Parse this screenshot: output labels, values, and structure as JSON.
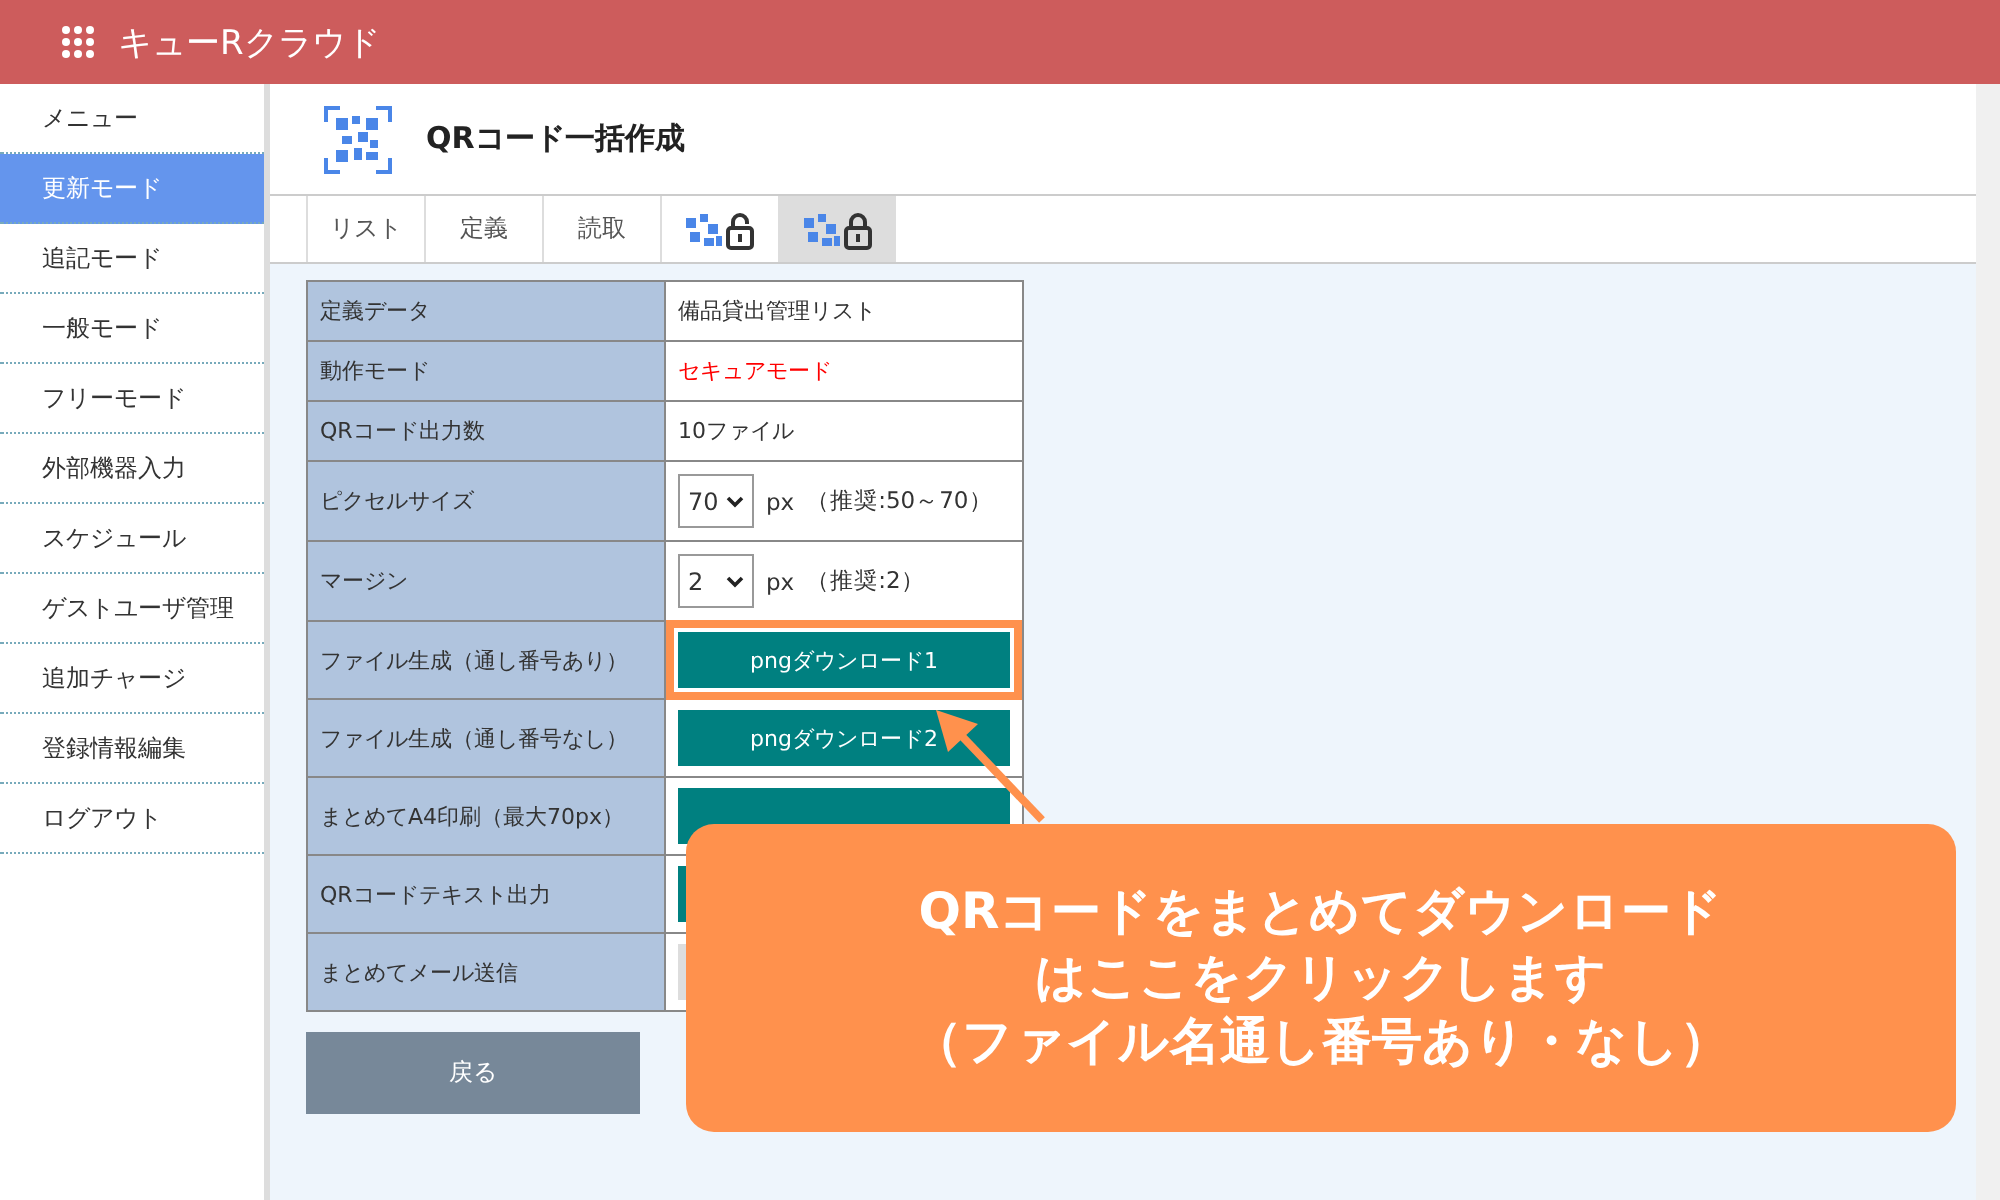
{
  "header": {
    "title": "キューRクラウド"
  },
  "sidebar": {
    "items": [
      {
        "label": "メニュー",
        "selected": false
      },
      {
        "label": "更新モード",
        "selected": true
      },
      {
        "label": "追記モード",
        "selected": false
      },
      {
        "label": "一般モード",
        "selected": false
      },
      {
        "label": "フリーモード",
        "selected": false
      },
      {
        "label": "外部機器入力",
        "selected": false
      },
      {
        "label": "スケジュール",
        "selected": false
      },
      {
        "label": "ゲストユーザ管理",
        "selected": false
      },
      {
        "label": "追加チャージ",
        "selected": false
      },
      {
        "label": "登録情報編集",
        "selected": false
      },
      {
        "label": "ログアウト",
        "selected": false
      }
    ]
  },
  "page": {
    "title": "QRコード一括作成"
  },
  "tabs": [
    {
      "kind": "text",
      "label": "リスト",
      "selected": false
    },
    {
      "kind": "text",
      "label": "定義",
      "selected": false
    },
    {
      "kind": "text",
      "label": "読取",
      "selected": false
    },
    {
      "kind": "qr-unlocked",
      "selected": false
    },
    {
      "kind": "qr-locked",
      "selected": true
    }
  ],
  "table": {
    "rows": [
      {
        "label": "定義データ",
        "kind": "text",
        "value": "備品貸出管理リスト"
      },
      {
        "label": "動作モード",
        "kind": "alert",
        "value": "セキュアモード"
      },
      {
        "label": "QRコード出力数",
        "kind": "text",
        "value": "10ファイル"
      },
      {
        "label": "ピクセルサイズ",
        "kind": "select",
        "value": "70",
        "unit": "px",
        "note": "（推奨:50～70）"
      },
      {
        "label": "マージン",
        "kind": "select",
        "value": "2",
        "unit": "px",
        "note": "（推奨:2）"
      },
      {
        "label": "ファイル生成（通し番号あり）",
        "kind": "button",
        "button": {
          "label": "pngダウンロード1",
          "kind": "primary",
          "highlighted": true
        }
      },
      {
        "label": "ファイル生成（通し番号なし）",
        "kind": "button",
        "button": {
          "label": "pngダウンロード2",
          "kind": "primary"
        }
      },
      {
        "label": "まとめてA4印刷（最大70px）",
        "kind": "button",
        "button": {
          "kind": "primary"
        }
      },
      {
        "label": "QRコードテキスト出力",
        "kind": "button",
        "button": {
          "kind": "primary"
        }
      },
      {
        "label": "まとめてメール送信",
        "kind": "button",
        "button": {
          "kind": "disabled"
        }
      }
    ]
  },
  "back_button": {
    "label": "戻る"
  },
  "callout": {
    "lines": [
      "QRコードをまとめてダウンロード",
      "はここをクリックします",
      "（ファイル名通し番号あり・なし）"
    ]
  }
}
